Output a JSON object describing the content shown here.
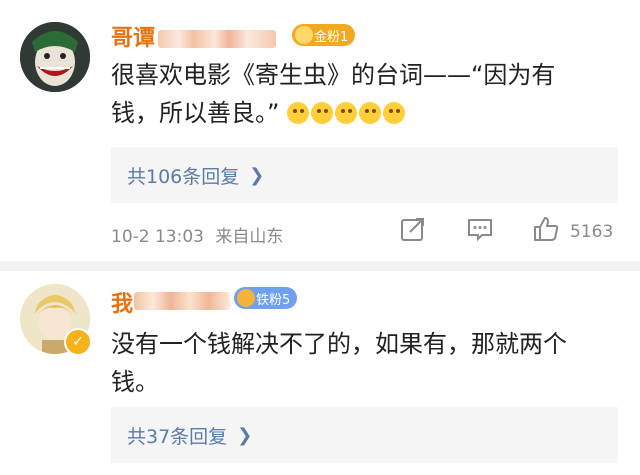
{
  "comments": [
    {
      "username": "哥谭",
      "fan_badge": "金粉1",
      "text_line1": "很喜欢电影《寄生虫》的台词——“因为有",
      "text_line2": "钱，所以善良。”",
      "emoji_count": 5,
      "replies_label": "共106条回复",
      "date": "10-2 13:03",
      "source": "来自山东",
      "likes": "5163",
      "badge_color": "#f3a91f"
    },
    {
      "username": "我",
      "fan_badge": "铁粉5",
      "text_line1": "没有一个钱解决不了的，如果有，那就两个",
      "text_line2": "钱。",
      "replies_label": "共37条回复",
      "badge_color": "#6ea0ee"
    }
  ],
  "icons": {
    "share": "share-icon",
    "comment": "comment-icon",
    "like": "thumbs-up-icon",
    "chevron": "chevron-right-icon"
  },
  "colors": {
    "username": "#e8730e",
    "link": "#5b7ba8",
    "meta": "#8a8a8a",
    "reply_bg": "#f5f5f5"
  }
}
